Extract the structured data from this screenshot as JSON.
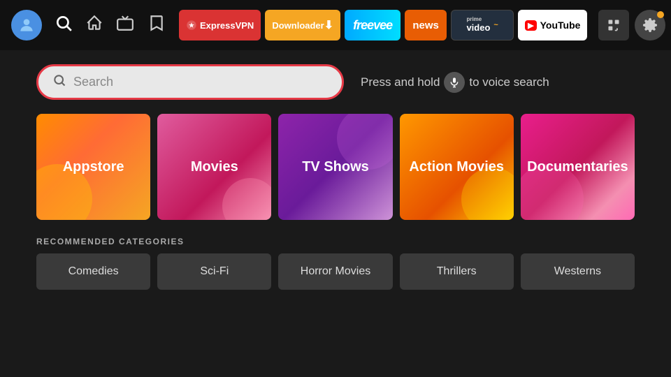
{
  "header": {
    "apps": [
      {
        "id": "expressvpn",
        "label": "ExpressVPN",
        "style": "app-expressvpn"
      },
      {
        "id": "downloader",
        "label": "Downloader ⬇",
        "style": "app-downloader"
      },
      {
        "id": "freevee",
        "label": "freevee",
        "style": "app-freevee"
      },
      {
        "id": "news",
        "label": "news",
        "style": "app-news"
      },
      {
        "id": "prime",
        "label": "prime video",
        "style": "app-prime"
      },
      {
        "id": "youtube",
        "label": "YouTube",
        "style": "app-youtube"
      }
    ]
  },
  "search": {
    "placeholder": "Search",
    "voice_hint_prefix": "Press and hold",
    "voice_hint_suffix": "to voice search"
  },
  "category_cards": [
    {
      "id": "appstore",
      "label": "Appstore",
      "style": "card-appstore"
    },
    {
      "id": "movies",
      "label": "Movies",
      "style": "card-movies"
    },
    {
      "id": "tvshows",
      "label": "TV Shows",
      "style": "card-tvshows"
    },
    {
      "id": "action-movies",
      "label": "Action Movies",
      "style": "card-action"
    },
    {
      "id": "documentaries",
      "label": "Documentaries",
      "style": "card-documentaries"
    }
  ],
  "recommended": {
    "title": "Recommended Categories",
    "items": [
      {
        "id": "comedies",
        "label": "Comedies"
      },
      {
        "id": "sci-fi",
        "label": "Sci-Fi"
      },
      {
        "id": "horror-movies",
        "label": "Horror Movies"
      },
      {
        "id": "thrillers",
        "label": "Thrillers"
      },
      {
        "id": "westerns",
        "label": "Westerns"
      }
    ]
  },
  "nav": {
    "icons": [
      "👤",
      "🔍",
      "🏠",
      "📺",
      "🔖"
    ],
    "settings_icon": "⚙️",
    "grid_icon": "⊞"
  }
}
